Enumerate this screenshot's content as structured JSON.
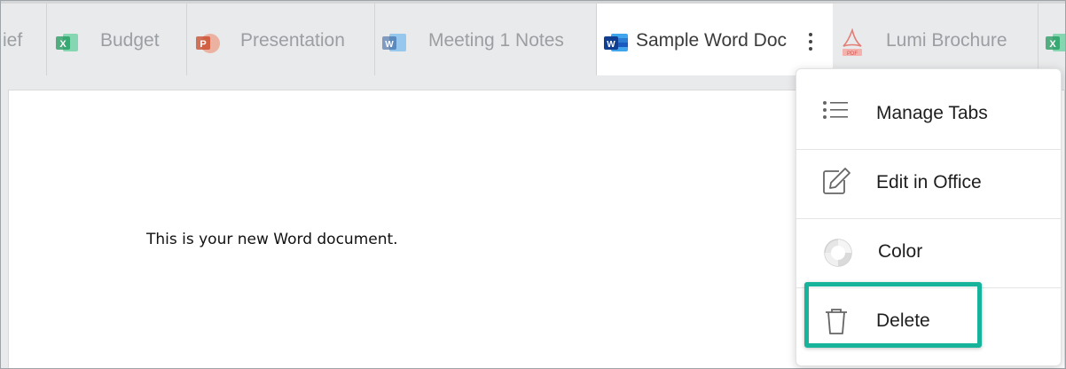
{
  "tabs": [
    {
      "label": "ief",
      "type": "partial"
    },
    {
      "label": "Budget",
      "type": "excel",
      "icon": "excel-icon"
    },
    {
      "label": "Presentation",
      "type": "powerpoint",
      "icon": "powerpoint-icon"
    },
    {
      "label": "Meeting 1 Notes",
      "type": "word",
      "icon": "word-icon"
    },
    {
      "label": "Sample Word Doc",
      "type": "word",
      "icon": "word-icon",
      "active": true
    },
    {
      "label": "Lumi Brochure",
      "type": "pdf",
      "icon": "pdf-icon"
    }
  ],
  "document": {
    "text": "This is your new Word document."
  },
  "menu": {
    "items": [
      {
        "label": "Manage Tabs",
        "icon": "list-icon"
      },
      {
        "label": "Edit in Office",
        "icon": "edit-icon"
      },
      {
        "label": "Color",
        "icon": "color-wheel-icon"
      },
      {
        "label": "Delete",
        "icon": "trash-icon",
        "highlighted": true
      }
    ]
  },
  "colors": {
    "highlight": "#17b39b",
    "excel": "#21a366",
    "powerpoint": "#d04423",
    "word": "#2b579a",
    "pdf": "#e0473c"
  }
}
